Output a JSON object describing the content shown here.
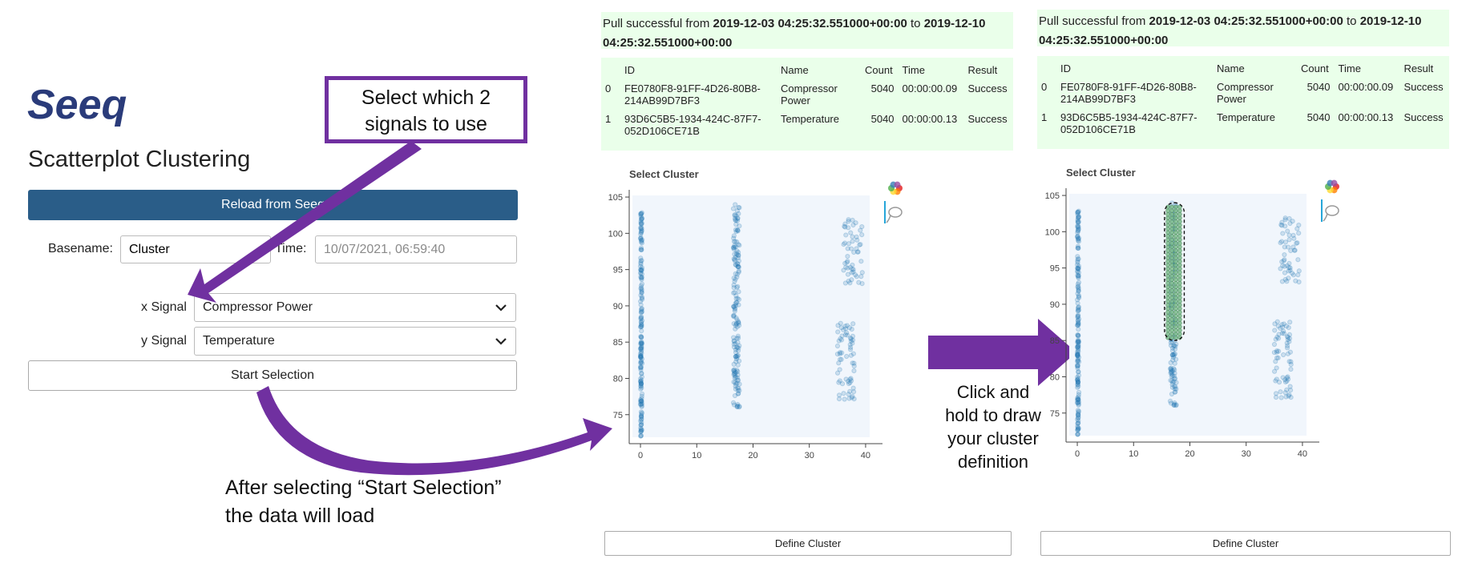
{
  "logo": {
    "text": "Seeq"
  },
  "app": {
    "title": "Scatterplot Clustering",
    "reload_label": "Reload from Seeq",
    "basename_label": "Basename:",
    "basename_value": "Cluster",
    "time_label": "Time:",
    "time_value": "10/07/2021, 06:59:40",
    "x_signal_label": "x Signal",
    "x_signal_value": "Compressor Power",
    "y_signal_label": "y Signal",
    "y_signal_value": "Temperature",
    "start_label": "Start Selection"
  },
  "annotations": {
    "select_signals_line1": "Select which 2",
    "select_signals_line2": "signals to use",
    "after_line1": "After selecting “Start Selection”",
    "after_line2": "the data will load",
    "click_line1": "Click and",
    "click_line2": "hold to draw",
    "click_line3": "your cluster",
    "click_line4": "definition",
    "accent": "#7030a0"
  },
  "panels": [
    {
      "status_prefix": "Pull successful from ",
      "status_start": "2019-12-03 04:25:32.551000+00:00",
      "status_mid": " to ",
      "status_end": "2019-12-10 04:25:32.551000+00:00",
      "columns": [
        "",
        "ID",
        "Name",
        "Count",
        "Time",
        "Result"
      ],
      "rows": [
        {
          "index": "0",
          "id": "FE0780F8-91FF-4D26-80B8-214AB99D7BF3",
          "name": "Compressor Power",
          "count": "5040",
          "time": "00:00:00.09",
          "result": "Success"
        },
        {
          "index": "1",
          "id": "93D6C5B5-1934-424C-87F7-052D106CE71B",
          "name": "Temperature",
          "count": "5040",
          "time": "00:00:00.13",
          "result": "Success"
        }
      ],
      "plot_title": "Select Cluster",
      "define_label": "Define Cluster"
    },
    {
      "status_prefix": "Pull successful from ",
      "status_start": "2019-12-03 04:25:32.551000+00:00",
      "status_mid": " to ",
      "status_end": "2019-12-10 04:25:32.551000+00:00",
      "columns": [
        "",
        "ID",
        "Name",
        "Count",
        "Time",
        "Result"
      ],
      "rows": [
        {
          "index": "0",
          "id": "FE0780F8-91FF-4D26-80B8-214AB99D7BF3",
          "name": "Compressor Power",
          "count": "5040",
          "time": "00:00:00.09",
          "result": "Success"
        },
        {
          "index": "1",
          "id": "93D6C5B5-1934-424C-87F7-052D106CE71B",
          "name": "Temperature",
          "count": "5040",
          "time": "00:00:00.13",
          "result": "Success"
        }
      ],
      "plot_title": "Select Cluster",
      "define_label": "Define Cluster"
    }
  ],
  "chart_data": [
    {
      "type": "scatter",
      "title": "Select Cluster",
      "xlim": [
        -2,
        43
      ],
      "ylim": [
        71,
        106
      ],
      "x_ticks": [
        "0",
        "10",
        "20",
        "30",
        "40"
      ],
      "y_ticks": [
        "75",
        "80",
        "85",
        "90",
        "95",
        "100",
        "105"
      ],
      "point_color": "#1f77b4",
      "clusters": [
        {
          "x": [
            0,
            0.3
          ],
          "y": [
            72,
            103
          ]
        },
        {
          "x": [
            16.5,
            17.6
          ],
          "y": [
            76,
            104
          ]
        },
        {
          "x": [
            36,
            39.5
          ],
          "y": [
            93,
            102
          ]
        },
        {
          "x": [
            35,
            38
          ],
          "y": [
            77,
            88
          ]
        }
      ],
      "selection": null
    },
    {
      "type": "scatter",
      "title": "Select Cluster",
      "xlim": [
        -2,
        43
      ],
      "ylim": [
        71,
        106
      ],
      "x_ticks": [
        "0",
        "10",
        "20",
        "30",
        "40"
      ],
      "y_ticks": [
        "75",
        "80",
        "85",
        "90",
        "95",
        "100",
        "105"
      ],
      "point_color": "#1f77b4",
      "clusters": [
        {
          "x": [
            0,
            0.3
          ],
          "y": [
            72,
            103
          ]
        },
        {
          "x": [
            16.5,
            17.6
          ],
          "y": [
            76,
            104
          ]
        },
        {
          "x": [
            36,
            39.5
          ],
          "y": [
            93,
            102
          ]
        },
        {
          "x": [
            35,
            38
          ],
          "y": [
            77,
            88
          ]
        }
      ],
      "selection": {
        "x": [
          15.5,
          19
        ],
        "y": [
          85,
          104
        ],
        "color": "#7ab88a"
      }
    }
  ]
}
